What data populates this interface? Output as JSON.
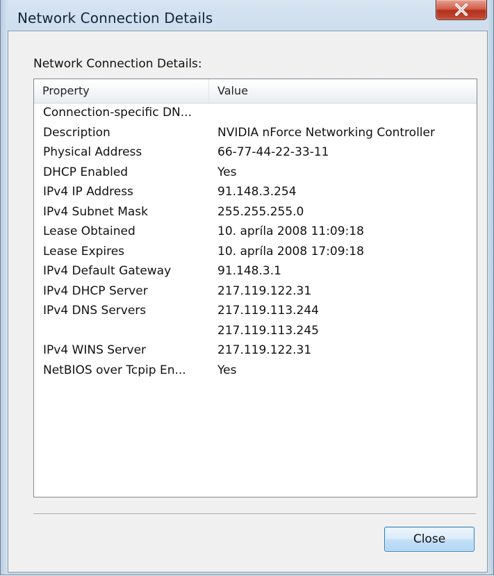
{
  "window": {
    "title": "Network Connection Details"
  },
  "content": {
    "group_label": "Network Connection Details:",
    "columns": {
      "property": "Property",
      "value": "Value"
    },
    "rows": [
      {
        "property": "Connection-specific DN...",
        "value": ""
      },
      {
        "property": "Description",
        "value": "NVIDIA nForce Networking Controller"
      },
      {
        "property": "Physical Address",
        "value": "66-77-44-22-33-11"
      },
      {
        "property": "DHCP Enabled",
        "value": "Yes"
      },
      {
        "property": "IPv4 IP Address",
        "value": "91.148.3.254"
      },
      {
        "property": "IPv4 Subnet Mask",
        "value": "255.255.255.0"
      },
      {
        "property": "Lease Obtained",
        "value": "10. apríla 2008 11:09:18"
      },
      {
        "property": "Lease Expires",
        "value": "10. apríla 2008 17:09:18"
      },
      {
        "property": "IPv4 Default Gateway",
        "value": "91.148.3.1"
      },
      {
        "property": "IPv4 DHCP Server",
        "value": "217.119.122.31"
      },
      {
        "property": "IPv4 DNS Servers",
        "value": "217.119.113.244"
      },
      {
        "property": "",
        "value": "217.119.113.245"
      },
      {
        "property": "IPv4 WINS Server",
        "value": "217.119.122.31"
      },
      {
        "property": "NetBIOS over Tcpip En...",
        "value": "Yes"
      }
    ]
  },
  "buttons": {
    "close_label": "Close",
    "title_close_icon": "close-x-icon"
  },
  "colors": {
    "title_close_red": "#c24f37",
    "button_blue_border": "#3c7fb1",
    "frame_blue": "#c9dbec"
  }
}
